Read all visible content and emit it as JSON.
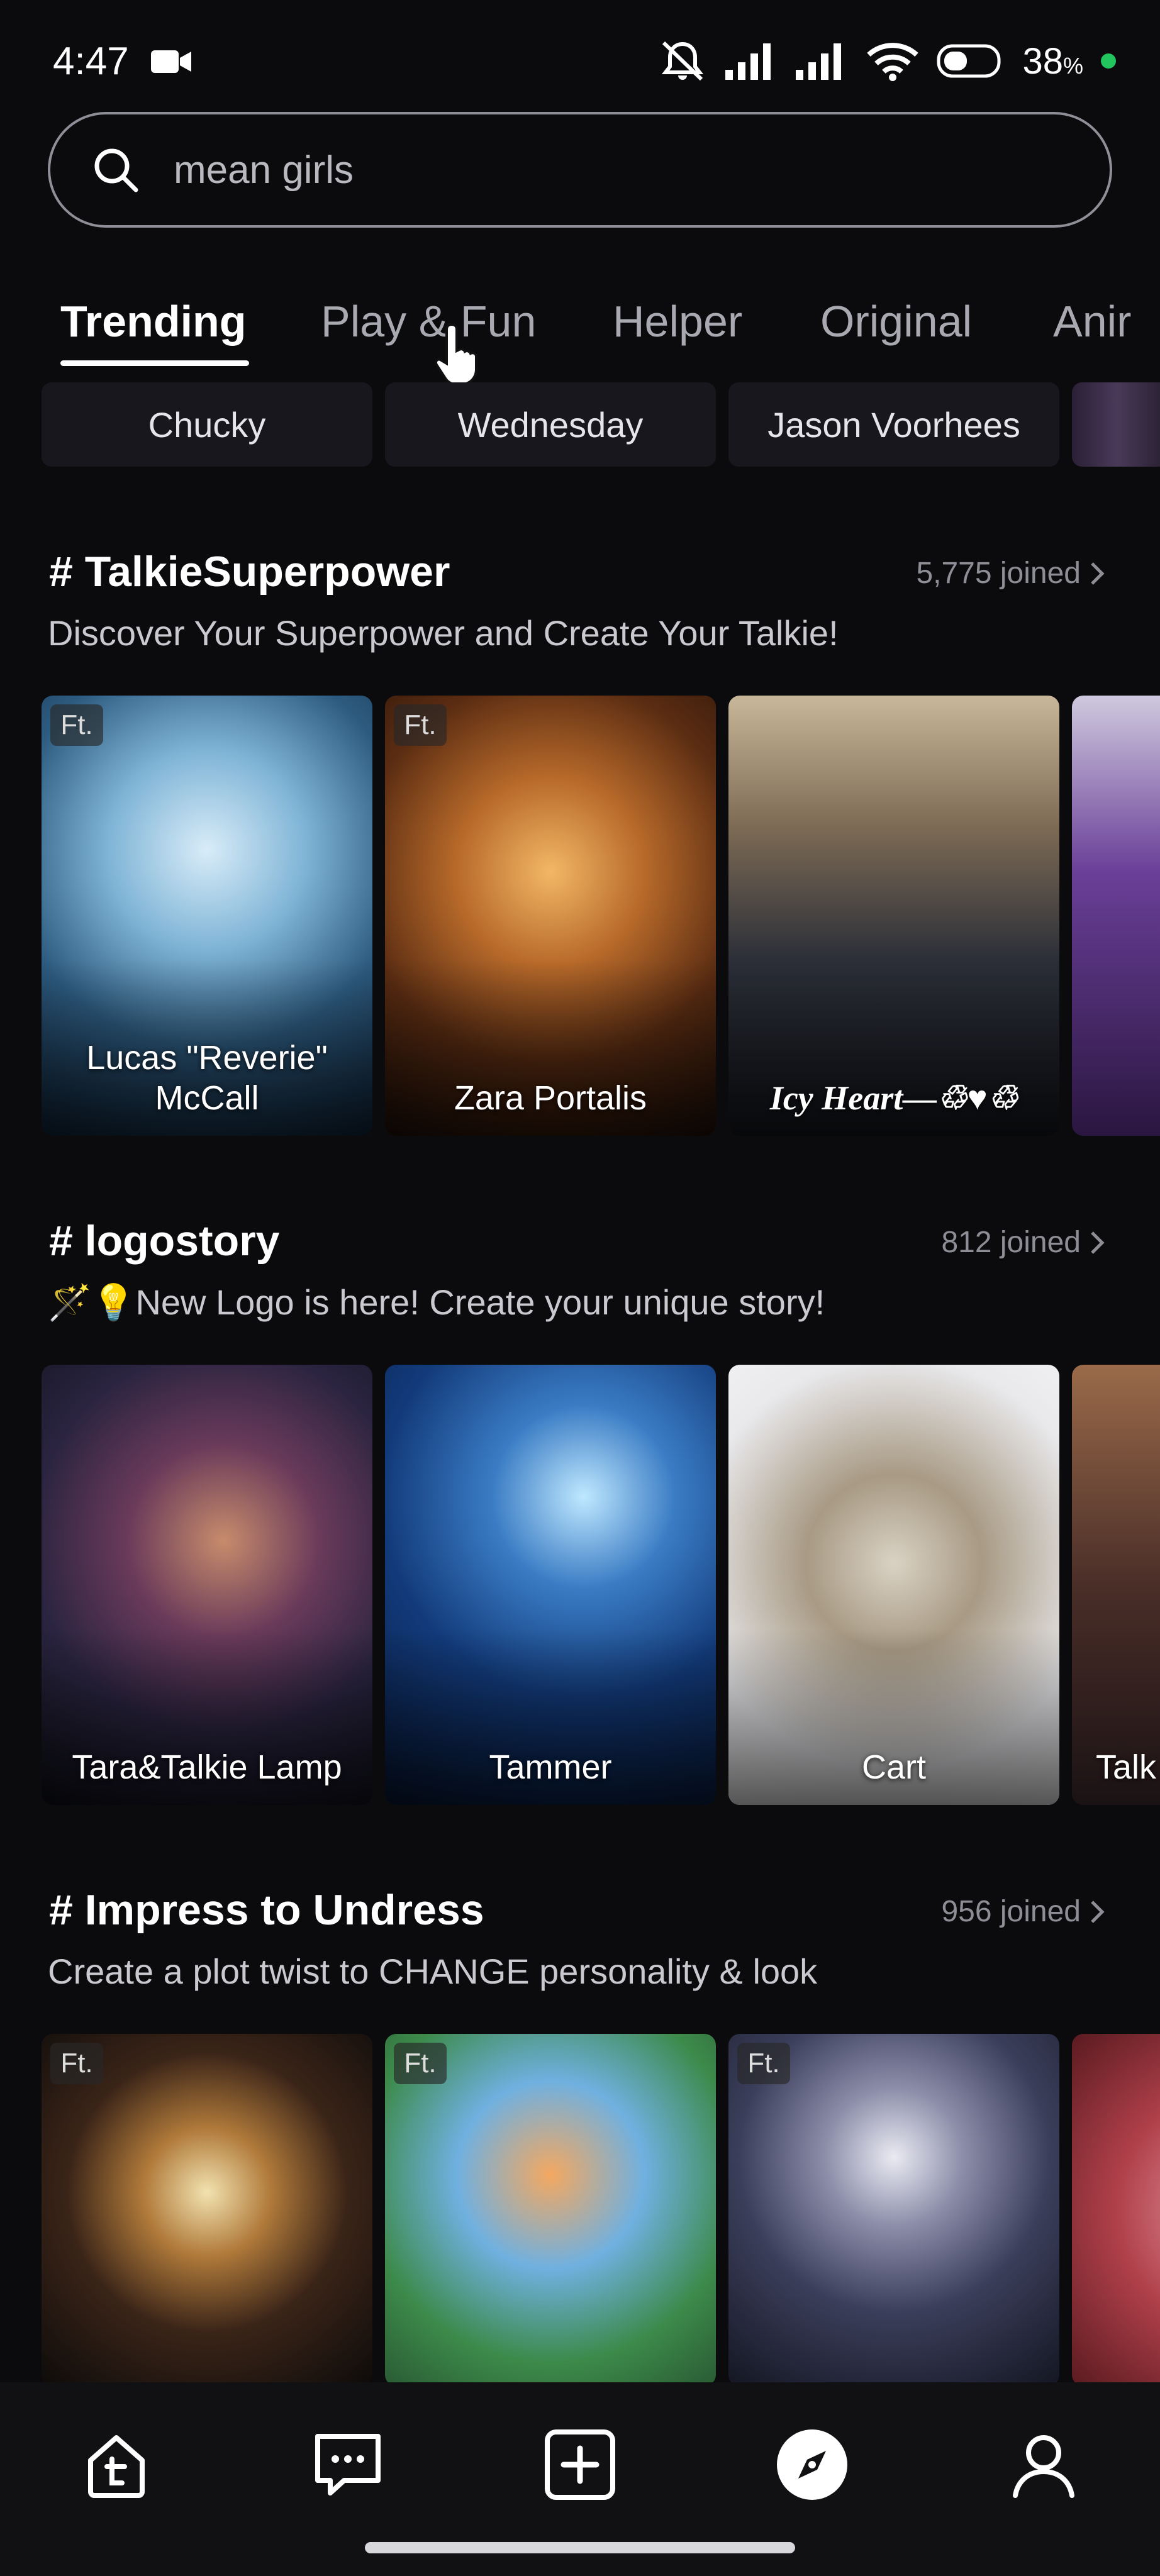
{
  "status_bar": {
    "time": "4:47",
    "battery": "38",
    "battery_unit": "%"
  },
  "search": {
    "value": "mean girls"
  },
  "tabs": [
    "Trending",
    "Play & Fun",
    "Helper",
    "Original",
    "Anir"
  ],
  "chips": [
    "Chucky",
    "Wednesday",
    "Jason Voorhees"
  ],
  "sections": [
    {
      "title": "# TalkieSuperpower",
      "joined": "5,775 joined",
      "description": "Discover Your Superpower and Create Your Talkie!",
      "cards": [
        {
          "name": "Lucas \"Reverie\" McCall",
          "badge": "Ft."
        },
        {
          "name": "Zara Portalis",
          "badge": "Ft."
        },
        {
          "name": "Icy Heart—♲♥♲"
        }
      ]
    },
    {
      "title": "# logostory",
      "joined": "812 joined",
      "description": "🪄💡New Logo is here! Create your unique story!",
      "cards": [
        {
          "name": "Tara&Talkie Lamp"
        },
        {
          "name": "Tammer"
        },
        {
          "name": "Cart"
        },
        {
          "name": "Talk"
        }
      ]
    },
    {
      "title": "# Impress to Undress",
      "joined": "956 joined",
      "description": "Create a plot twist to CHANGE personality & look",
      "cards": [
        {
          "badge": "Ft."
        },
        {
          "badge": "Ft."
        },
        {
          "badge": "Ft."
        }
      ]
    }
  ],
  "icons": {
    "status": [
      "camera-icon",
      "muted-bell-icon",
      "signal-icon",
      "wifi-icon",
      "battery-icon"
    ],
    "nav": [
      "home-icon",
      "chat-icon",
      "create-icon",
      "explore-icon",
      "profile-icon"
    ]
  },
  "colors": {
    "background": "#0b0b0e",
    "accent_green": "#22c55e",
    "chip_bg": "#17171d"
  }
}
